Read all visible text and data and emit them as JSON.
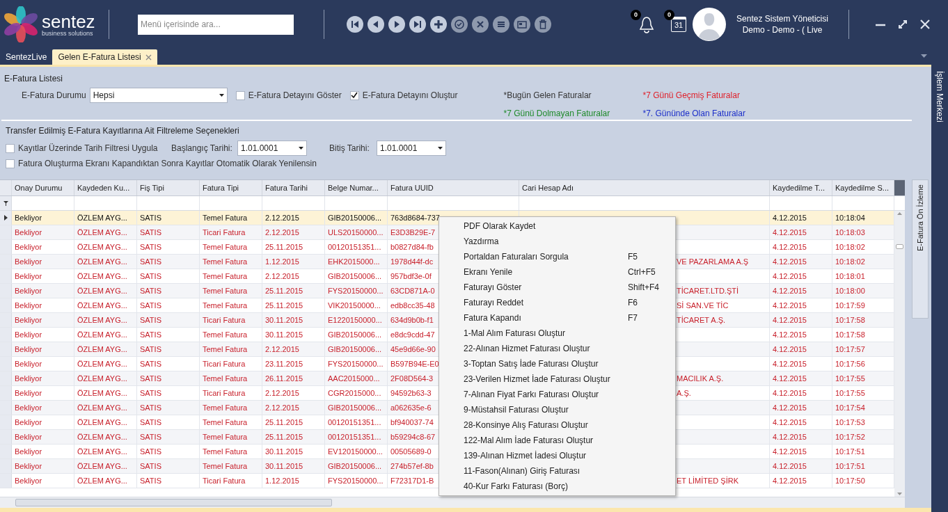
{
  "header": {
    "logo_name": "sentez",
    "logo_tagline": "business solutions",
    "search": {
      "placeholder": "Menü içerisinde ara..."
    },
    "toolbar": [
      {
        "kind": "first",
        "disabled": false
      },
      {
        "kind": "prev",
        "disabled": false
      },
      {
        "kind": "next",
        "disabled": false
      },
      {
        "kind": "last",
        "disabled": false
      },
      {
        "kind": "add",
        "disabled": false
      },
      {
        "kind": "approve",
        "disabled": true
      },
      {
        "kind": "cancel",
        "disabled": true
      },
      {
        "kind": "list",
        "disabled": true
      },
      {
        "kind": "card",
        "disabled": true
      },
      {
        "kind": "delete",
        "disabled": true
      }
    ],
    "notifications": {
      "count": "0"
    },
    "calendar": {
      "count": "0",
      "day": "31"
    },
    "user": {
      "name": "Sentez Sistem Yöneticisi",
      "company": "Demo - Demo - ( Live"
    }
  },
  "tabs": [
    {
      "label": "SentezLive",
      "selected": false,
      "closable": false
    },
    {
      "label": "Gelen E-Fatura Listesi",
      "selected": true,
      "closable": true
    }
  ],
  "side_panel": {
    "title": "İşlem Merkezi"
  },
  "preview_tab": {
    "label": "E-Fatura Ön İzleme"
  },
  "efatura_section": {
    "title": "E-Fatura Listesi",
    "status_label": "E-Fatura Durumu",
    "status_value": "Hepsi",
    "checkboxes": [
      {
        "label": "E-Fatura Detayını Göster",
        "checked": false
      },
      {
        "label": "E-Fatura Detayını Oluştur",
        "checked": true
      }
    ],
    "legend": [
      {
        "label": "*Bugün Gelen Faturalar",
        "color": "#333333"
      },
      {
        "label": "*7 Günü Geçmiş Faturalar",
        "color": "#e0202a"
      },
      {
        "label": "*7 Günü Dolmayan Faturalar",
        "color": "#1f8a2a"
      },
      {
        "label": "*7. Gününde Olan Faturalar",
        "color": "#1c2fc9"
      }
    ]
  },
  "filter_section": {
    "title": "Transfer Edilmiş E-Fatura Kayıtlarına Ait Filtreleme Seçenekleri",
    "date_filter": {
      "label": "Kayıtlar Üzerinde Tarih Filtresi Uygula",
      "checked": false
    },
    "start_label": "Başlangıç Tarihi:",
    "start_value": "1.01.0001",
    "end_label": "Bitiş Tarihi:",
    "end_value": "1.01.0001",
    "auto_refresh": {
      "label": "Fatura Oluşturma Ekranı Kapandıktan Sonra Kayıtlar Otomatik Olarak Yenilensin",
      "checked": false
    }
  },
  "table": {
    "columns": [
      "Onay Durumu",
      "Kaydeden Ku...",
      "Fiş Tipi",
      "Fatura Tipi",
      "Fatura Tarihi",
      "Belge Numar...",
      "Fatura UUID",
      "Cari Hesap Adı",
      "Kaydedilme T...",
      "Kaydedilme S..."
    ],
    "rows": [
      {
        "selected": true,
        "cells": [
          "Bekliyor",
          "ÖZLEM AYG...",
          "SATIS",
          "Temel Fatura",
          "2.12.2015",
          "GIB20150006...",
          "763d8684-737",
          "",
          "4.12.2015",
          "10:18:04"
        ]
      },
      {
        "selected": false,
        "cells": [
          "Bekliyor",
          "ÖZLEM AYG...",
          "SATIS",
          "Ticari Fatura",
          "2.12.2015",
          "ULS20150000...",
          "E3D3B29E-7",
          "",
          "4.12.2015",
          "10:18:03"
        ]
      },
      {
        "selected": false,
        "cells": [
          "Bekliyor",
          "ÖZLEM AYG...",
          "SATIS",
          "Temel Fatura",
          "25.11.2015",
          "00120151351...",
          "b0827d84-fb",
          "",
          "4.12.2015",
          "10:18:02"
        ]
      },
      {
        "selected": false,
        "cells": [
          "Bekliyor",
          "ÖZLEM AYG...",
          "SATIS",
          "Temel Fatura",
          "1.12.2015",
          "EHK2015000...",
          "1978d44f-dc",
          "VE PAZARLAMA A.Ş",
          "4.12.2015",
          "10:18:02"
        ]
      },
      {
        "selected": false,
        "cells": [
          "Bekliyor",
          "ÖZLEM AYG...",
          "SATIS",
          "Temel Fatura",
          "2.12.2015",
          "GIB20150006...",
          "957bdf3e-0f",
          "",
          "4.12.2015",
          "10:18:01"
        ]
      },
      {
        "selected": false,
        "cells": [
          "Bekliyor",
          "ÖZLEM AYG...",
          "SATIS",
          "Temel Fatura",
          "25.11.2015",
          "FYS20150000...",
          "63CD871A-0",
          "TİCARET.LTD.ŞTİ",
          "4.12.2015",
          "10:18:00"
        ]
      },
      {
        "selected": false,
        "cells": [
          "Bekliyor",
          "ÖZLEM AYG...",
          "SATIS",
          "Temel Fatura",
          "25.11.2015",
          "VIK20150000...",
          "edb8cc35-48",
          "Sİ SAN.VE TİC",
          "4.12.2015",
          "10:17:59"
        ]
      },
      {
        "selected": false,
        "cells": [
          "Bekliyor",
          "ÖZLEM AYG...",
          "SATIS",
          "Ticari Fatura",
          "30.11.2015",
          "E1220150000...",
          "634d9b0b-f1",
          "TİCARET A.Ş.",
          "4.12.2015",
          "10:17:58"
        ]
      },
      {
        "selected": false,
        "cells": [
          "Bekliyor",
          "ÖZLEM AYG...",
          "SATIS",
          "Temel Fatura",
          "30.11.2015",
          "GIB20150006...",
          "e8dc9cdd-47",
          "",
          "4.12.2015",
          "10:17:58"
        ]
      },
      {
        "selected": false,
        "cells": [
          "Bekliyor",
          "ÖZLEM AYG...",
          "SATIS",
          "Temel Fatura",
          "2.12.2015",
          "GIB20150006...",
          "45e9d66e-90",
          "",
          "4.12.2015",
          "10:17:57"
        ]
      },
      {
        "selected": false,
        "cells": [
          "Bekliyor",
          "ÖZLEM AYG...",
          "SATIS",
          "Ticari Fatura",
          "23.11.2015",
          "FYS20150000...",
          "B597B94E-E0",
          "",
          "4.12.2015",
          "10:17:56"
        ]
      },
      {
        "selected": false,
        "cells": [
          "Bekliyor",
          "ÖZLEM AYG...",
          "SATIS",
          "Temel Fatura",
          "26.11.2015",
          "AAC2015000...",
          "2F08D564-3",
          "MACILIK A.Ş.",
          "4.12.2015",
          "10:17:55"
        ]
      },
      {
        "selected": false,
        "cells": [
          "Bekliyor",
          "ÖZLEM AYG...",
          "SATIS",
          "Ticari Fatura",
          "2.12.2015",
          "CGR2015000...",
          "94592b63-3",
          "A.Ş.",
          "4.12.2015",
          "10:17:55"
        ]
      },
      {
        "selected": false,
        "cells": [
          "Bekliyor",
          "ÖZLEM AYG...",
          "SATIS",
          "Temel Fatura",
          "2.12.2015",
          "GIB20150006...",
          "a062635e-6",
          "",
          "4.12.2015",
          "10:17:54"
        ]
      },
      {
        "selected": false,
        "cells": [
          "Bekliyor",
          "ÖZLEM AYG...",
          "SATIS",
          "Temel Fatura",
          "25.11.2015",
          "00120151351...",
          "bf940037-74",
          "",
          "4.12.2015",
          "10:17:53"
        ]
      },
      {
        "selected": false,
        "cells": [
          "Bekliyor",
          "ÖZLEM AYG...",
          "SATIS",
          "Temel Fatura",
          "25.11.2015",
          "00120151351...",
          "b59294c8-67",
          "",
          "4.12.2015",
          "10:17:52"
        ]
      },
      {
        "selected": false,
        "cells": [
          "Bekliyor",
          "ÖZLEM AYG...",
          "SATIS",
          "Temel Fatura",
          "30.11.2015",
          "EV120150000...",
          "00505689-0",
          "",
          "4.12.2015",
          "10:17:51"
        ]
      },
      {
        "selected": false,
        "cells": [
          "Bekliyor",
          "ÖZLEM AYG...",
          "SATIS",
          "Temel Fatura",
          "30.11.2015",
          "GIB20150006...",
          "274b57ef-8b",
          "",
          "4.12.2015",
          "10:17:51"
        ]
      },
      {
        "selected": false,
        "cells": [
          "Bekliyor",
          "ÖZLEM AYG...",
          "SATIS",
          "Ticari Fatura",
          "1.12.2015",
          "FYS20150000...",
          "F72317D1-B",
          "ET LİMİTED ŞİRK",
          "4.12.2015",
          "10:17:50"
        ]
      }
    ]
  },
  "context_menu": [
    {
      "label": "PDF Olarak Kaydet"
    },
    {
      "label": "Yazdırma"
    },
    {
      "label": "Portaldan Faturaları Sorgula",
      "shortcut": "F5"
    },
    {
      "label": "Ekranı Yenile",
      "shortcut": "Ctrl+F5"
    },
    {
      "label": "Faturayı Göster",
      "shortcut": "Shift+F4"
    },
    {
      "label": "Faturayı Reddet",
      "shortcut": "F6"
    },
    {
      "label": "Fatura Kapandı",
      "shortcut": "F7"
    },
    {
      "label": "1-Mal Alım Faturası Oluştur"
    },
    {
      "label": "22-Alınan Hizmet Faturası Oluştur"
    },
    {
      "label": "3-Toptan Satış İade Faturası Oluştur"
    },
    {
      "label": "23-Verilen Hizmet İade Faturası Oluştur"
    },
    {
      "label": "7-Alınan Fiyat Farkı Faturası Oluştur"
    },
    {
      "label": "9-Müstahsil Faturası Oluştur"
    },
    {
      "label": "28-Konsinye Alış Faturası Oluştur"
    },
    {
      "label": "122-Mal Alım İade Faturası Oluştur"
    },
    {
      "label": "139-Alınan Hizmet İadesi Oluştur"
    },
    {
      "label": "11-Fason(Alınan) Giriş Faturası"
    },
    {
      "label": "40-Kur Farkı Faturası (Borç)"
    }
  ]
}
